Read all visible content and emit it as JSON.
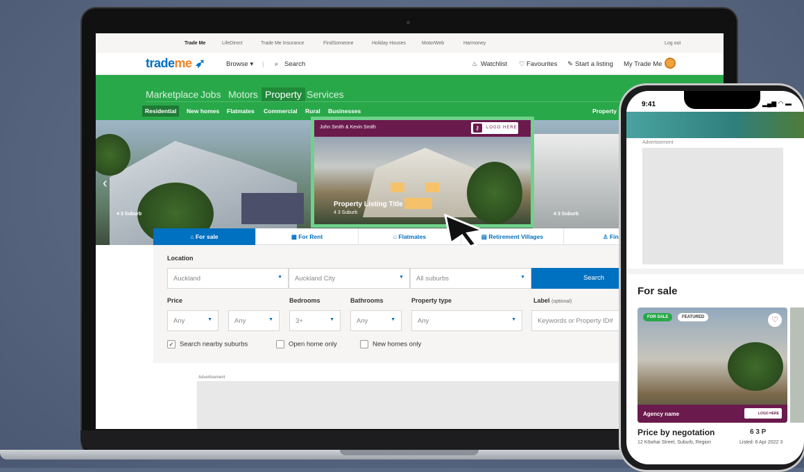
{
  "topbar": {
    "links": [
      "Trade Me",
      "LifeDirect",
      "Trade Me Insurance",
      "FindSomeone",
      "Holiday Houses",
      "MotorWeb",
      "Harmoney"
    ],
    "logout": "Log out"
  },
  "header": {
    "logo_main": "trade",
    "logo_accent": "me",
    "browse": "Browse ▾",
    "search": "Search",
    "watchlist": "Watchlist",
    "favourites": "Favourites",
    "start_listing": "Start a listing",
    "my_trade_me": "My Trade Me"
  },
  "main_nav": [
    "Marketplace",
    "Jobs",
    "Motors",
    "Property",
    "Services"
  ],
  "sub_nav": [
    "Residential",
    "New homes",
    "Flatmates",
    "Commercial",
    "Rural",
    "Businesses"
  ],
  "sub_nav_right": "Property",
  "hero": {
    "left_meta": "4  3  Suburb",
    "right_meta": "4  3  Suburb",
    "featured": {
      "agents": "John Smith & Kevin Smith",
      "logo": "LOGO HERE",
      "title": "Property Listing Title",
      "meta": "4  3  Suburb"
    }
  },
  "tabs": [
    "For sale",
    "For Rent",
    "Flatmates",
    "Retirement Villages",
    "Find a"
  ],
  "form": {
    "location_label": "Location",
    "region": "Auckland",
    "district": "Auckland City",
    "suburb": "All suburbs",
    "search_button": "Search",
    "price_label": "Price",
    "price_min": "Any",
    "price_max": "Any",
    "bedrooms_label": "Bedrooms",
    "bedrooms": "3+",
    "bathrooms_label": "Bathrooms",
    "bathrooms": "Any",
    "property_type_label": "Property type",
    "property_type": "Any",
    "label_label": "Label",
    "label_optional": "(optional)",
    "keywords_placeholder": "Keywords or Property ID#",
    "nearby": "Search nearby suburbs",
    "nearby_checked": true,
    "open_home": "Open home only",
    "new_homes": "New homes only"
  },
  "advertisement": "Advertisement",
  "phone": {
    "time": "9:41",
    "status": "▂▄▆ ◠ ▬",
    "ad_label": "Advertisement",
    "section_title": "For sale",
    "badge_for_sale": "FOR SALE",
    "badge_featured": "FEATURED",
    "agency": "Agency name",
    "logo": "LOGO HERE",
    "price": "Price by negotation",
    "features": "6  3  P",
    "address": "12 Kōwhai Street, Suburb, Region",
    "listed": "Listed: 6 Apr 2022  3"
  },
  "colors": {
    "brand_green": "#29a84a",
    "brand_blue": "#0070c0",
    "agency_purple": "#6b1a4d",
    "highlight_green": "#6fd18b"
  }
}
